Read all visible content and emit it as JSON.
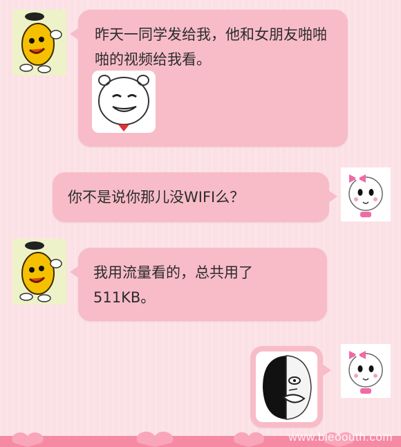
{
  "messages": [
    {
      "sender": "yellow-bean",
      "side": "left",
      "text": "昨天一同学发给我，他和女朋友啪啪啪的视频给我看。",
      "sticker": "grinning-panda-face"
    },
    {
      "sender": "pink-bow-girl",
      "side": "right",
      "text": "你不是说你那儿没WIFI么？"
    },
    {
      "sender": "yellow-bean",
      "side": "left",
      "text": "我用流量看的，总共用了511KB。"
    },
    {
      "sender": "pink-bow-girl",
      "side": "right",
      "sticker": "half-black-meme-face"
    }
  ],
  "watermark": "www.bieoouth.com",
  "colors": {
    "bubble": "#f7bcc8",
    "background": "#fbe1e6",
    "text": "#2b2b2b"
  }
}
